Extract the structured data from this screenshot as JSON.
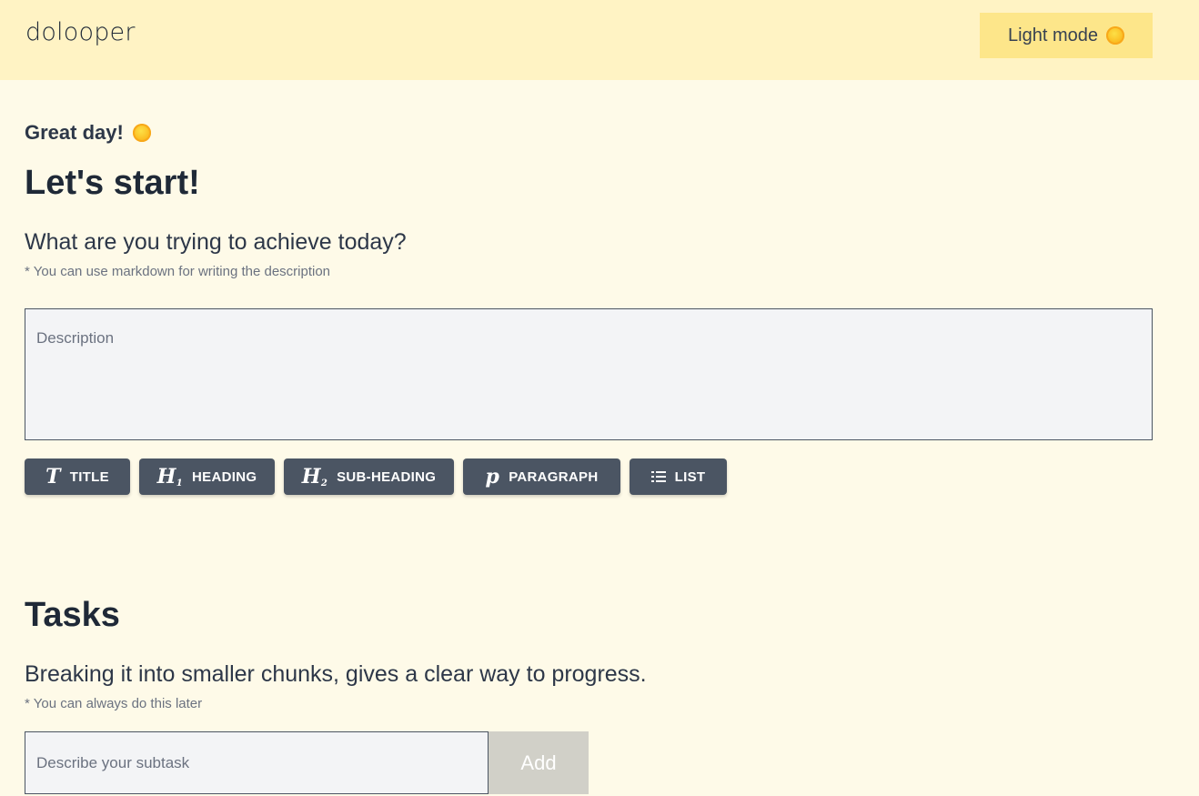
{
  "header": {
    "logo": "dolooper",
    "mode_button": {
      "label": "Light mode",
      "icon": "sun-icon"
    }
  },
  "intro": {
    "greeting": "Great day!",
    "greeting_icon": "sun-icon",
    "title": "Let's start!",
    "question": "What are you trying to achieve today?",
    "hint": "* You can use markdown for writing the description"
  },
  "description": {
    "placeholder": "Description",
    "value": ""
  },
  "toolbar": {
    "buttons": [
      {
        "label": "TITLE",
        "icon": "title-T-icon"
      },
      {
        "label": "HEADING",
        "icon": "heading-h1-icon"
      },
      {
        "label": "SUB-HEADING",
        "icon": "subheading-h2-icon"
      },
      {
        "label": "PARAGRAPH",
        "icon": "paragraph-p-icon"
      },
      {
        "label": "LIST",
        "icon": "list-icon"
      }
    ]
  },
  "tasks": {
    "title": "Tasks",
    "subtitle": "Breaking it into smaller chunks, gives a clear way to progress.",
    "hint": "* You can always do this later",
    "input_placeholder": "Describe your subtask",
    "input_value": "",
    "add_label": "Add"
  },
  "colors": {
    "page_bg": "#fefae8",
    "header_bg": "#fff3c4",
    "mode_button_bg": "#fde68a",
    "toolbar_button_bg": "#4b5563",
    "add_button_bg": "#d1d0c8"
  }
}
